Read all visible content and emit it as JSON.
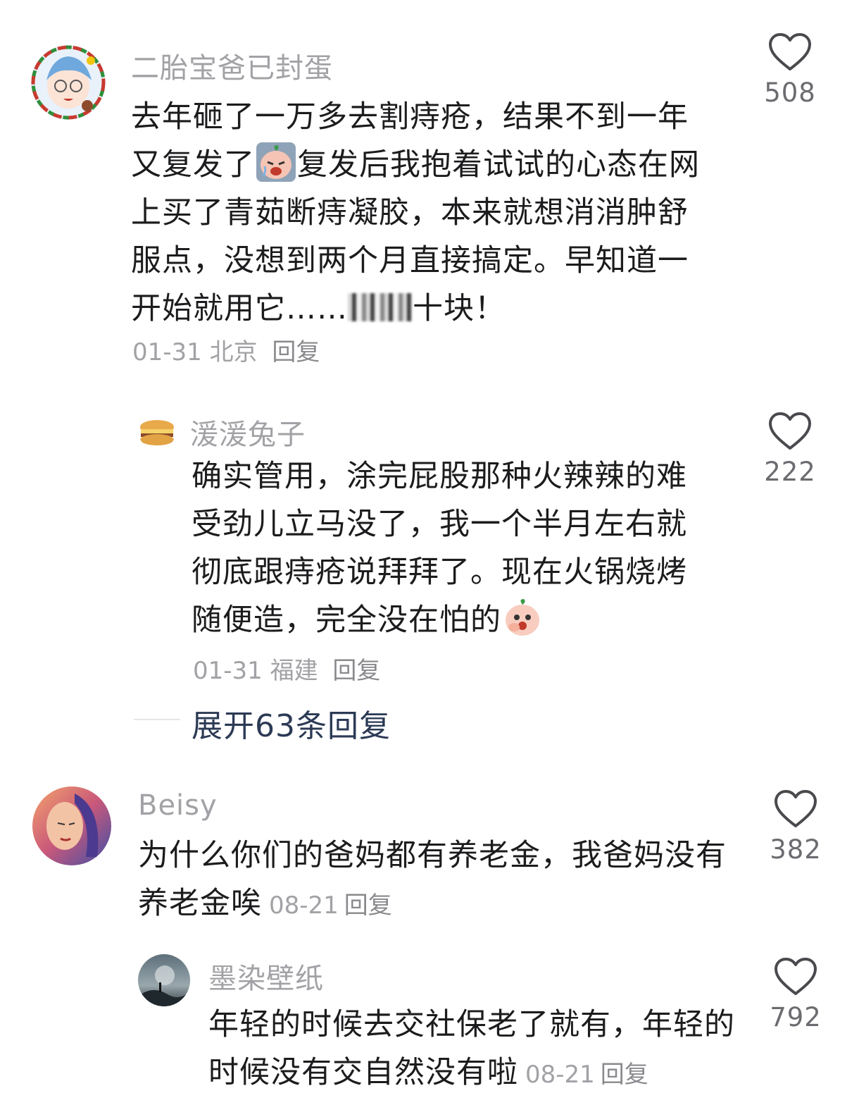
{
  "comments": [
    {
      "username": "二胎宝爸已封蛋",
      "text_parts": [
        "去年砸了一万多去割痔疮，结果不到一年又复发了",
        "复发后我抱着试试的心态在网上买了青茹断痔凝胶，本来就想消消肿舒服点，没想到两个月直接搞定。早知道一开始就用它……",
        "十块！"
      ],
      "emoji": "crying-peach-emoji",
      "date": "01-31",
      "location": "北京",
      "reply_label": "回复",
      "likes": "508"
    },
    {
      "username": "湲湲兔子",
      "text_parts": [
        "确实管用，涂完屁股那种火辣辣的难受劲儿立马没了，我一个半月左右就彻底跟痔疮说拜拜了。现在火锅烧烤随便造，完全没在怕的"
      ],
      "emoji": "surprised-peach-emoji",
      "date": "01-31",
      "location": "福建",
      "reply_label": "回复",
      "likes": "222"
    },
    {
      "username": "Beisy",
      "text_parts": [
        "为什么你们的爸妈都有养老金，我爸妈没有养老金唉"
      ],
      "date": "08-21",
      "reply_label": "回复",
      "likes": "382"
    },
    {
      "username": "墨染壁纸",
      "text_parts": [
        "年轻的时候去交社保老了就有，年轻的时候没有交自然没有啦"
      ],
      "date": "08-21",
      "reply_label": "回复",
      "likes": "792"
    }
  ],
  "expand_replies": "展开63条回复",
  "colors": {
    "username": "#a2a2a6",
    "body": "#1c1c1e",
    "expand": "#2c3a55",
    "like": "#6b6b70"
  },
  "icons": [
    "heart-outline-icon"
  ]
}
